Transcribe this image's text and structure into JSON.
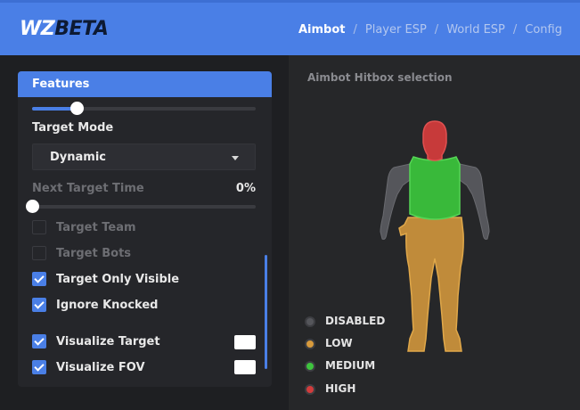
{
  "header": {
    "logo_a": "WZ",
    "logo_b": "BETA",
    "tabs": [
      {
        "label": "Aimbot"
      },
      {
        "label": "Player ESP"
      },
      {
        "label": "World ESP"
      },
      {
        "label": "Config"
      }
    ],
    "separator": "/",
    "active_tab": "Aimbot"
  },
  "features": {
    "title": "Features",
    "top_slider_value": 0.2,
    "target_mode_label": "Target Mode",
    "target_mode_value": "Dynamic",
    "next_target_label": "Next Target Time",
    "next_target_value": "0%",
    "next_target_slider": 0.0,
    "options": [
      {
        "label": "Target Team",
        "checked": false,
        "enabled": false
      },
      {
        "label": "Target Bots",
        "checked": false,
        "enabled": false
      },
      {
        "label": "Target Only Visible",
        "checked": true,
        "enabled": true
      },
      {
        "label": "Ignore Knocked",
        "checked": true,
        "enabled": true
      },
      {
        "label": "Visualize Target",
        "checked": true,
        "enabled": true
      },
      {
        "label": "Visualize FOV",
        "checked": true,
        "enabled": true
      }
    ]
  },
  "hitbox": {
    "title": "Aimbot Hitbox selection",
    "legend": [
      {
        "label": "DISABLED",
        "color": "#55565b"
      },
      {
        "label": "LOW",
        "color": "#d79a3c"
      },
      {
        "label": "MEDIUM",
        "color": "#3ec43e"
      },
      {
        "label": "HIGH",
        "color": "#d23c3c"
      }
    ],
    "colors": {
      "head": "#c73a3a",
      "torso": "#39b93a",
      "arms": "#55565b",
      "legs": "#c08b3a"
    }
  }
}
